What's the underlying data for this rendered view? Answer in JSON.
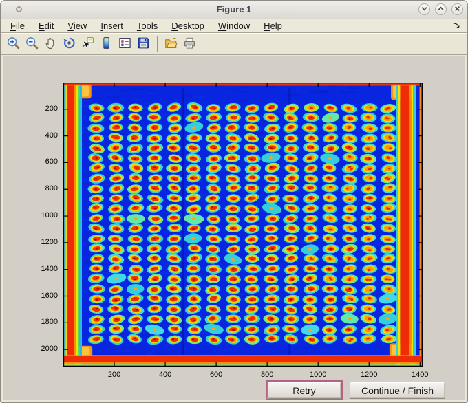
{
  "window": {
    "title": "Figure 1",
    "controls": [
      {
        "name": "minimize",
        "glyph": "chevron-down"
      },
      {
        "name": "maximize",
        "glyph": "chevron-up"
      },
      {
        "name": "close",
        "glyph": "cross"
      }
    ]
  },
  "menu_bar": {
    "items": [
      {
        "label": "File",
        "mnemonic": "F"
      },
      {
        "label": "Edit",
        "mnemonic": "E"
      },
      {
        "label": "View",
        "mnemonic": "V"
      },
      {
        "label": "Insert",
        "mnemonic": "I"
      },
      {
        "label": "Tools",
        "mnemonic": "T"
      },
      {
        "label": "Desktop",
        "mnemonic": "D"
      },
      {
        "label": "Window",
        "mnemonic": "W"
      },
      {
        "label": "Help",
        "mnemonic": "H"
      }
    ],
    "dock_button": "dock-figure"
  },
  "toolbar": {
    "items": [
      "zoom-in",
      "zoom-out",
      "pan",
      "rotate-3d",
      "data-cursor",
      "insert-colorbar",
      "insert-legend",
      "save-figure",
      "separator",
      "open-file",
      "print-figure"
    ]
  },
  "buttons": {
    "retry_label": "Retry",
    "continue_label": "Continue / Finish",
    "retry_focus_color": "#b5617f"
  },
  "figure": {
    "background_color": "#d3cfc6",
    "chrome_color": "#eae7d8"
  },
  "chart_data": {
    "type": "heatmap",
    "title": "",
    "xlabel": "",
    "ylabel": "",
    "colormap": "jet",
    "xlim": [
      0,
      1410
    ],
    "ylim": [
      0,
      2128
    ],
    "x_ticks": [
      200,
      400,
      600,
      800,
      1000,
      1200,
      1400
    ],
    "y_ticks": [
      200,
      400,
      600,
      800,
      1000,
      1200,
      1400,
      1600,
      1800,
      2000
    ],
    "grid": false,
    "legend": false,
    "description": "Pseudocolor (jet) image of a scanned microarray plate: a 24-row by 16-column grid of circular spots with hot (red/orange) centers and cyan halos on a blue background, framed by red border bands along all four plate edges",
    "background_value_color": "#0826df",
    "border_band_color": "#ee2d06",
    "spot_halo_color": "#35cfdb",
    "spot_ring_color": "#ffd803",
    "spot_core_color": "#ef2f05",
    "spot_grid": {
      "rows": 24,
      "cols": 16,
      "x_start": 130,
      "x_step": 76.4,
      "y_start": 190,
      "y_step": 75.4,
      "spot_diameter": 58
    }
  }
}
